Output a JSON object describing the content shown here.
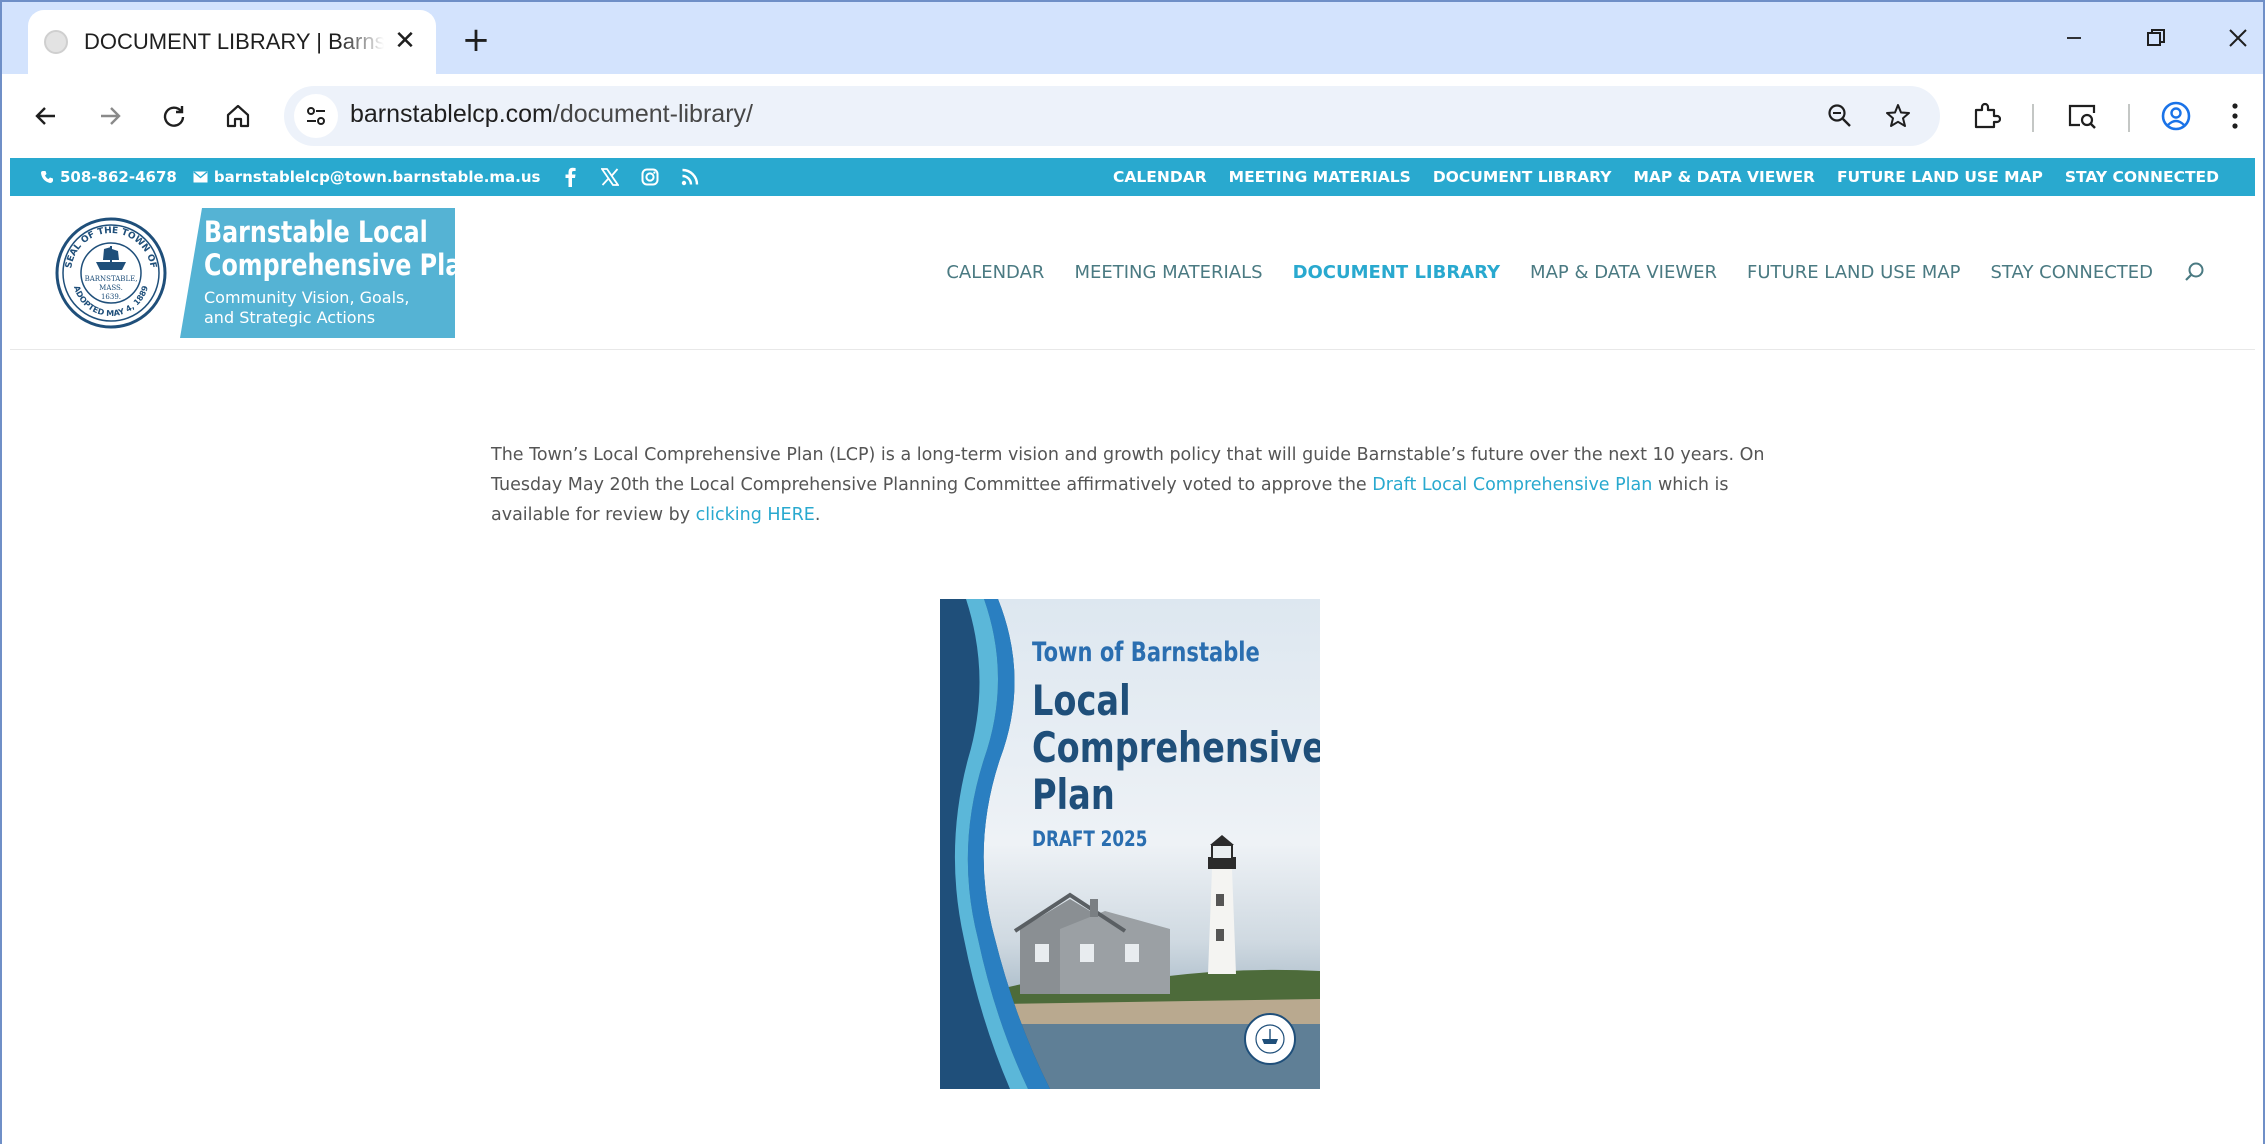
{
  "browser": {
    "tab_title": "DOCUMENT LIBRARY | Barnstable Local Comprehensive Plan",
    "tab_close": "✕",
    "new_tab": "+",
    "url_host": "barnstablelcp.com",
    "url_path": "/document-library/"
  },
  "topbar": {
    "phone": "508-862-4678",
    "email": "barnstablelcp@town.barnstable.ma.us",
    "social": [
      "facebook-icon",
      "x-icon",
      "instagram-icon",
      "rss-icon"
    ],
    "links": [
      "CALENDAR",
      "MEETING MATERIALS",
      "DOCUMENT LIBRARY",
      "MAP & DATA VIEWER",
      "FUTURE LAND USE MAP",
      "STAY CONNECTED"
    ]
  },
  "logo": {
    "title_line1": "Barnstable Local",
    "title_line2": "Comprehensive Plan",
    "subtitle_line1": "Community Vision, Goals,",
    "subtitle_line2": "and Strategic Actions",
    "seal_text": "SEAL OF THE TOWN OF BARNSTABLE MASS. 1639 ADOPTED MAY 4, 1889"
  },
  "main_nav": {
    "links": [
      "CALENDAR",
      "MEETING MATERIALS",
      "DOCUMENT LIBRARY",
      "MAP & DATA VIEWER",
      "FUTURE LAND USE MAP",
      "STAY CONNECTED"
    ],
    "active_index": 2
  },
  "content": {
    "intro_part1": "The Town’s Local Comprehensive Plan (LCP) is a long-term vision and growth policy that will guide Barnstable’s future over the next 10 years. On Tuesday May 20th the Local Comprehensive Planning Committee affirmatively voted to approve the ",
    "intro_link1": "Draft Local Comprehensive Plan",
    "intro_part2": " which is available for review by ",
    "intro_link2": "clicking HERE",
    "intro_part3": "."
  },
  "cover": {
    "town": "Town of Barnstable",
    "title_line1": "Local",
    "title_line2": "Comprehensive",
    "title_line3": "Plan",
    "draft": "DRAFT 2025"
  },
  "colors": {
    "accent": "#29a9cf",
    "logo_bg": "#55b3d4",
    "nav_text": "#4a7a82",
    "tabstrip": "#d3e3fd"
  }
}
